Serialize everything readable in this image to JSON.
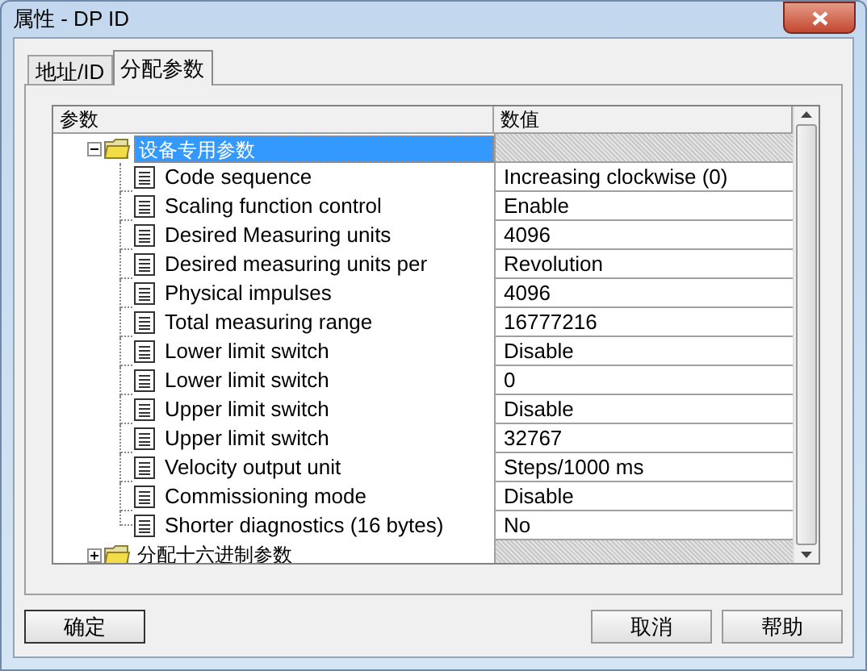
{
  "window": {
    "title": "属性 - DP ID"
  },
  "tabs": [
    {
      "label": "地址/ID",
      "selected": false
    },
    {
      "label": "分配参数",
      "selected": true
    }
  ],
  "table": {
    "columns": [
      "参数",
      "数值"
    ],
    "groups": [
      {
        "label": "设备专用参数",
        "expanded": true,
        "selected": true,
        "children": [
          {
            "name": "Code sequence",
            "value": "Increasing clockwise (0)"
          },
          {
            "name": "Scaling function control",
            "value": "Enable"
          },
          {
            "name": "Desired Measuring units",
            "value": "4096"
          },
          {
            "name": "Desired measuring units per",
            "value": "Revolution"
          },
          {
            "name": "Physical impulses",
            "value": "4096"
          },
          {
            "name": "Total measuring range",
            "value": "16777216"
          },
          {
            "name": "Lower limit switch",
            "value": "Disable"
          },
          {
            "name": "Lower limit switch",
            "value": "0"
          },
          {
            "name": "Upper limit switch",
            "value": "Disable"
          },
          {
            "name": "Upper limit switch",
            "value": "32767"
          },
          {
            "name": "Velocity output unit",
            "value": "Steps/1000 ms"
          },
          {
            "name": "Commissioning mode",
            "value": "Disable"
          },
          {
            "name": "Shorter diagnostics (16 bytes)",
            "value": "No"
          }
        ]
      },
      {
        "label": "分配十六进制参数",
        "expanded": false,
        "selected": false
      }
    ]
  },
  "buttons": [
    "确定",
    "取消",
    "帮助"
  ]
}
